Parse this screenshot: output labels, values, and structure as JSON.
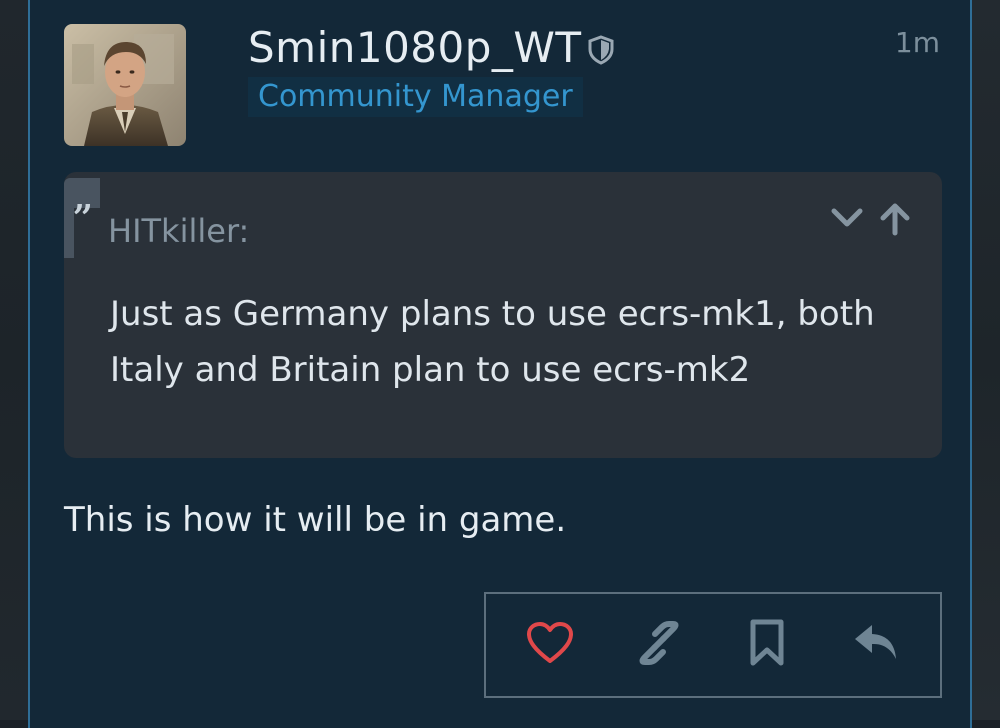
{
  "post": {
    "username": "Smin1080p_WT",
    "role": "Community Manager",
    "timestamp": "1m",
    "badge_icon": "shield-icon",
    "quote": {
      "author": "HITkiller:",
      "text": "Just as Germany plans to use ecrs-mk1, both Italy and Britain plan to use ecrs-mk2"
    },
    "body": "This is how it will be in game.",
    "actions": [
      "like",
      "copy-link",
      "bookmark",
      "reply"
    ]
  },
  "colors": {
    "post_bg": "#132838",
    "accent": "#2f6e97",
    "role_text": "#3496cf",
    "like": "#e0484a",
    "icon_muted": "#6f8594"
  }
}
